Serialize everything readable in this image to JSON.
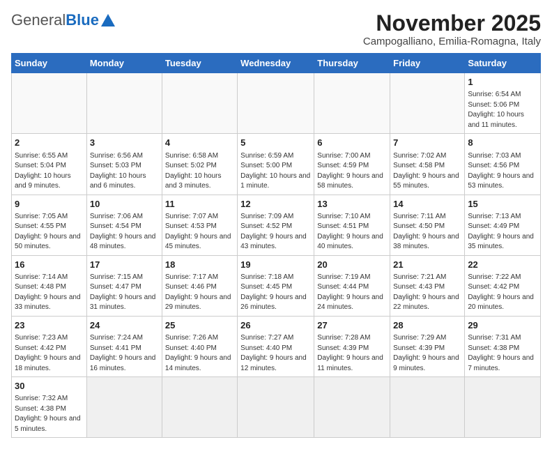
{
  "header": {
    "logo_general": "General",
    "logo_blue": "Blue",
    "month_title": "November 2025",
    "location": "Campogalliano, Emilia-Romagna, Italy"
  },
  "weekdays": [
    "Sunday",
    "Monday",
    "Tuesday",
    "Wednesday",
    "Thursday",
    "Friday",
    "Saturday"
  ],
  "weeks": [
    [
      {
        "day": "",
        "info": ""
      },
      {
        "day": "",
        "info": ""
      },
      {
        "day": "",
        "info": ""
      },
      {
        "day": "",
        "info": ""
      },
      {
        "day": "",
        "info": ""
      },
      {
        "day": "",
        "info": ""
      },
      {
        "day": "1",
        "info": "Sunrise: 6:54 AM\nSunset: 5:06 PM\nDaylight: 10 hours and 11 minutes."
      }
    ],
    [
      {
        "day": "2",
        "info": "Sunrise: 6:55 AM\nSunset: 5:04 PM\nDaylight: 10 hours and 9 minutes."
      },
      {
        "day": "3",
        "info": "Sunrise: 6:56 AM\nSunset: 5:03 PM\nDaylight: 10 hours and 6 minutes."
      },
      {
        "day": "4",
        "info": "Sunrise: 6:58 AM\nSunset: 5:02 PM\nDaylight: 10 hours and 3 minutes."
      },
      {
        "day": "5",
        "info": "Sunrise: 6:59 AM\nSunset: 5:00 PM\nDaylight: 10 hours and 1 minute."
      },
      {
        "day": "6",
        "info": "Sunrise: 7:00 AM\nSunset: 4:59 PM\nDaylight: 9 hours and 58 minutes."
      },
      {
        "day": "7",
        "info": "Sunrise: 7:02 AM\nSunset: 4:58 PM\nDaylight: 9 hours and 55 minutes."
      },
      {
        "day": "8",
        "info": "Sunrise: 7:03 AM\nSunset: 4:56 PM\nDaylight: 9 hours and 53 minutes."
      }
    ],
    [
      {
        "day": "9",
        "info": "Sunrise: 7:05 AM\nSunset: 4:55 PM\nDaylight: 9 hours and 50 minutes."
      },
      {
        "day": "10",
        "info": "Sunrise: 7:06 AM\nSunset: 4:54 PM\nDaylight: 9 hours and 48 minutes."
      },
      {
        "day": "11",
        "info": "Sunrise: 7:07 AM\nSunset: 4:53 PM\nDaylight: 9 hours and 45 minutes."
      },
      {
        "day": "12",
        "info": "Sunrise: 7:09 AM\nSunset: 4:52 PM\nDaylight: 9 hours and 43 minutes."
      },
      {
        "day": "13",
        "info": "Sunrise: 7:10 AM\nSunset: 4:51 PM\nDaylight: 9 hours and 40 minutes."
      },
      {
        "day": "14",
        "info": "Sunrise: 7:11 AM\nSunset: 4:50 PM\nDaylight: 9 hours and 38 minutes."
      },
      {
        "day": "15",
        "info": "Sunrise: 7:13 AM\nSunset: 4:49 PM\nDaylight: 9 hours and 35 minutes."
      }
    ],
    [
      {
        "day": "16",
        "info": "Sunrise: 7:14 AM\nSunset: 4:48 PM\nDaylight: 9 hours and 33 minutes."
      },
      {
        "day": "17",
        "info": "Sunrise: 7:15 AM\nSunset: 4:47 PM\nDaylight: 9 hours and 31 minutes."
      },
      {
        "day": "18",
        "info": "Sunrise: 7:17 AM\nSunset: 4:46 PM\nDaylight: 9 hours and 29 minutes."
      },
      {
        "day": "19",
        "info": "Sunrise: 7:18 AM\nSunset: 4:45 PM\nDaylight: 9 hours and 26 minutes."
      },
      {
        "day": "20",
        "info": "Sunrise: 7:19 AM\nSunset: 4:44 PM\nDaylight: 9 hours and 24 minutes."
      },
      {
        "day": "21",
        "info": "Sunrise: 7:21 AM\nSunset: 4:43 PM\nDaylight: 9 hours and 22 minutes."
      },
      {
        "day": "22",
        "info": "Sunrise: 7:22 AM\nSunset: 4:42 PM\nDaylight: 9 hours and 20 minutes."
      }
    ],
    [
      {
        "day": "23",
        "info": "Sunrise: 7:23 AM\nSunset: 4:42 PM\nDaylight: 9 hours and 18 minutes."
      },
      {
        "day": "24",
        "info": "Sunrise: 7:24 AM\nSunset: 4:41 PM\nDaylight: 9 hours and 16 minutes."
      },
      {
        "day": "25",
        "info": "Sunrise: 7:26 AM\nSunset: 4:40 PM\nDaylight: 9 hours and 14 minutes."
      },
      {
        "day": "26",
        "info": "Sunrise: 7:27 AM\nSunset: 4:40 PM\nDaylight: 9 hours and 12 minutes."
      },
      {
        "day": "27",
        "info": "Sunrise: 7:28 AM\nSunset: 4:39 PM\nDaylight: 9 hours and 11 minutes."
      },
      {
        "day": "28",
        "info": "Sunrise: 7:29 AM\nSunset: 4:39 PM\nDaylight: 9 hours and 9 minutes."
      },
      {
        "day": "29",
        "info": "Sunrise: 7:31 AM\nSunset: 4:38 PM\nDaylight: 9 hours and 7 minutes."
      }
    ],
    [
      {
        "day": "30",
        "info": "Sunrise: 7:32 AM\nSunset: 4:38 PM\nDaylight: 9 hours and 5 minutes."
      },
      {
        "day": "",
        "info": ""
      },
      {
        "day": "",
        "info": ""
      },
      {
        "day": "",
        "info": ""
      },
      {
        "day": "",
        "info": ""
      },
      {
        "day": "",
        "info": ""
      },
      {
        "day": "",
        "info": ""
      }
    ]
  ]
}
